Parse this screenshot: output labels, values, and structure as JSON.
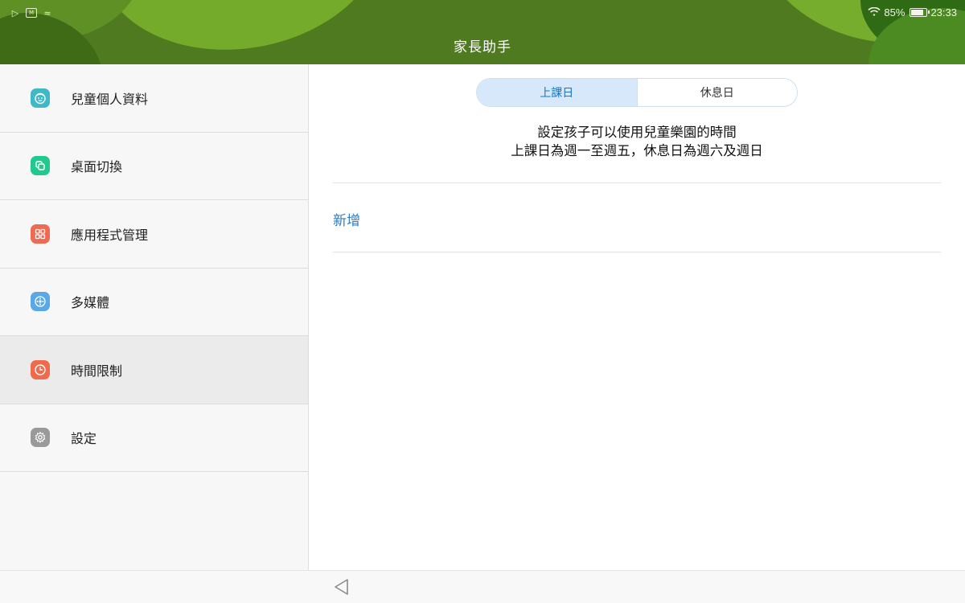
{
  "status_bar": {
    "icons_left": [
      "play-store-icon",
      "gallery-icon",
      "cast-icon"
    ],
    "wifi_icon": "wifi-icon",
    "battery_percent": "85%",
    "battery_level": 0.85,
    "time": "23:33"
  },
  "header": {
    "title": "家長助手"
  },
  "sidebar": {
    "items": [
      {
        "label": "兒童個人資料",
        "icon": "child-face-icon",
        "color": "#3fb8c8"
      },
      {
        "label": "桌面切換",
        "icon": "switch-desktop-icon",
        "color": "#22c98f"
      },
      {
        "label": "應用程式管理",
        "icon": "app-grid-icon",
        "color": "#ef6a52"
      },
      {
        "label": "多媒體",
        "icon": "media-icon",
        "color": "#5aa8e6"
      },
      {
        "label": "時間限制",
        "icon": "clock-icon",
        "color": "#f06a4c",
        "active": true
      },
      {
        "label": "設定",
        "icon": "gear-icon",
        "color": "#9a9a9a"
      }
    ]
  },
  "main": {
    "tabs": [
      {
        "label": "上課日",
        "active": true
      },
      {
        "label": "休息日",
        "active": false
      }
    ],
    "description_line1": "設定孩子可以使用兒童樂園的時間",
    "description_line2": "上課日為週一至週五，休息日為週六及週日",
    "add_label": "新增"
  },
  "navbar": {
    "back_icon": "back-triangle-icon"
  },
  "colors": {
    "header": "#4f7a1f",
    "accent": "#2b7cc4",
    "tab_active_bg": "#d6e8fa"
  }
}
